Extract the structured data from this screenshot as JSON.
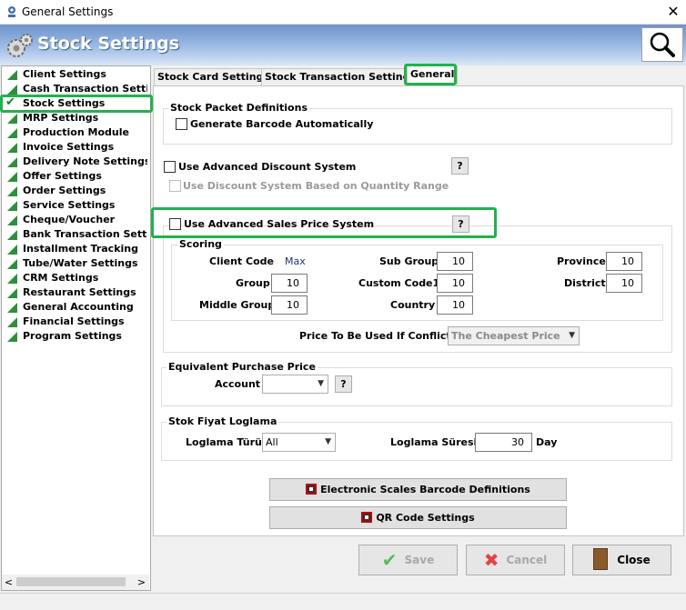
{
  "window": {
    "title": "General Settings",
    "close_glyph": "✕"
  },
  "header": {
    "title": "Stock Settings",
    "search_icon": "magnifier-icon"
  },
  "nav": {
    "items": [
      {
        "label": "Client Settings"
      },
      {
        "label": "Cash Transaction Settings"
      },
      {
        "label": "Stock Settings",
        "selected": true
      },
      {
        "label": "MRP Settings"
      },
      {
        "label": "Production Module"
      },
      {
        "label": "Invoice Settings"
      },
      {
        "label": "Delivery Note Settings"
      },
      {
        "label": "Offer Settings"
      },
      {
        "label": "Order Settings"
      },
      {
        "label": "Service Settings"
      },
      {
        "label": "Cheque/Voucher"
      },
      {
        "label": "Bank Transaction Settings"
      },
      {
        "label": "Installment Tracking"
      },
      {
        "label": "Tube/Water Settings"
      },
      {
        "label": "CRM Settings"
      },
      {
        "label": "Restaurant Settings"
      },
      {
        "label": "General Accounting"
      },
      {
        "label": "Financial Settings"
      },
      {
        "label": "Program Settings"
      }
    ],
    "scroll_left": "<",
    "scroll_right": ">"
  },
  "tabs": [
    {
      "label": "Stock Card Settings"
    },
    {
      "label": "Stock Transaction Settings"
    },
    {
      "label": "General",
      "active": true
    }
  ],
  "stock_packet": {
    "title": "Stock Packet Definitions",
    "generate_barcode": "Generate Barcode Automatically"
  },
  "discount": {
    "use_advanced": "Use Advanced Discount System",
    "quantity_range": "Use Discount System Based on Quantity Range",
    "help": "?"
  },
  "sales_price": {
    "use_advanced": "Use Advanced Sales Price System",
    "help": "?",
    "scoring": {
      "title": "Scoring",
      "client_code_label": "Client Code",
      "client_code_value": "Max",
      "group_label": "Group",
      "group_value": "10",
      "middle_group_label": "Middle Group",
      "middle_group_value": "10",
      "sub_group_label": "Sub Group",
      "sub_group_value": "10",
      "custom_code1_label": "Custom Code1",
      "custom_code1_value": "10",
      "country_label": "Country",
      "country_value": "10",
      "province_label": "Province",
      "province_value": "10",
      "district_label": "District",
      "district_value": "10"
    },
    "conflict_label": "Price To Be Used If Conflicts",
    "conflict_value": "The Cheapest Price"
  },
  "equivalent_purchase": {
    "title": "Equivalent Purchase Price",
    "account_label": "Account",
    "account_value": "",
    "help": "?"
  },
  "stok_fiyat": {
    "title": "Stok Fiyat Loglama",
    "loglama_turu_label": "Loglama Türü",
    "loglama_turu_value": "All",
    "loglama_suresi_label": "Loglama Süresi",
    "loglama_suresi_value": "30",
    "unit": "Day"
  },
  "buttons": {
    "scales_barcode": "Electronic Scales Barcode Definitions",
    "qr_code": "QR Code Settings",
    "save": "Save",
    "cancel": "Cancel",
    "close": "Close"
  },
  "colors": {
    "highlight": "#22b14c",
    "nav_icon": "#2e8f3a",
    "header_gradient_top": "#6e93c9"
  }
}
